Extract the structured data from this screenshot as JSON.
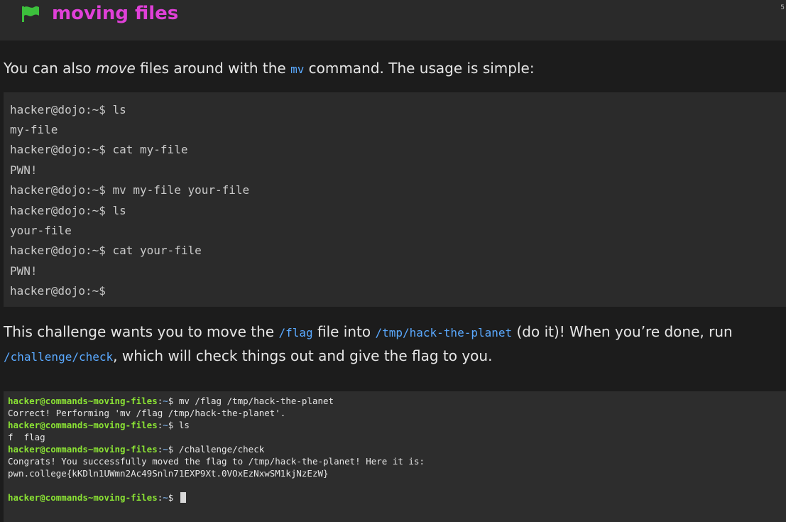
{
  "header": {
    "title": "moving files",
    "corner_mark": "5",
    "icon": "flag-icon",
    "title_color": "#e040d8",
    "icon_color": "#3cbf3c"
  },
  "intro": {
    "before": "You can also ",
    "emphasis": "move",
    "middle": " files around with the ",
    "command": "mv",
    "after": " command. The usage is simple:"
  },
  "example_lines": [
    "hacker@dojo:~$ ls",
    "my-file",
    "hacker@dojo:~$ cat my-file",
    "PWN!",
    "hacker@dojo:~$ mv my-file your-file",
    "hacker@dojo:~$ ls",
    "your-file",
    "hacker@dojo:~$ cat your-file",
    "PWN!",
    "hacker@dojo:~$"
  ],
  "task": {
    "t1": "This challenge wants you to move the ",
    "flag_path": "/flag",
    "t2": " file into ",
    "dest_path": "/tmp/hack-the-planet",
    "t3": " (do it)! When you’re done, run",
    "check_cmd": "/challenge/check",
    "t4": ", which will check things out and give the flag to you."
  },
  "terminal": {
    "user": "hacker@commands~moving-files",
    "sep": ":",
    "dir": "~",
    "prompt_end": "$ ",
    "cmd1": "mv /flag /tmp/hack-the-planet",
    "out1": "Correct! Performing 'mv /flag /tmp/hack-the-planet'.",
    "cmd2": "ls",
    "out2": "f  flag",
    "cmd3": "/challenge/check",
    "out3a": "Congrats! You successfully moved the flag to /tmp/hack-the-planet! Here it is:",
    "out3b": "pwn.college{kKDln1UWmn2Ac49Snln71EXP9Xt.0VOxEzNxwSM1kjNzEzW}"
  }
}
